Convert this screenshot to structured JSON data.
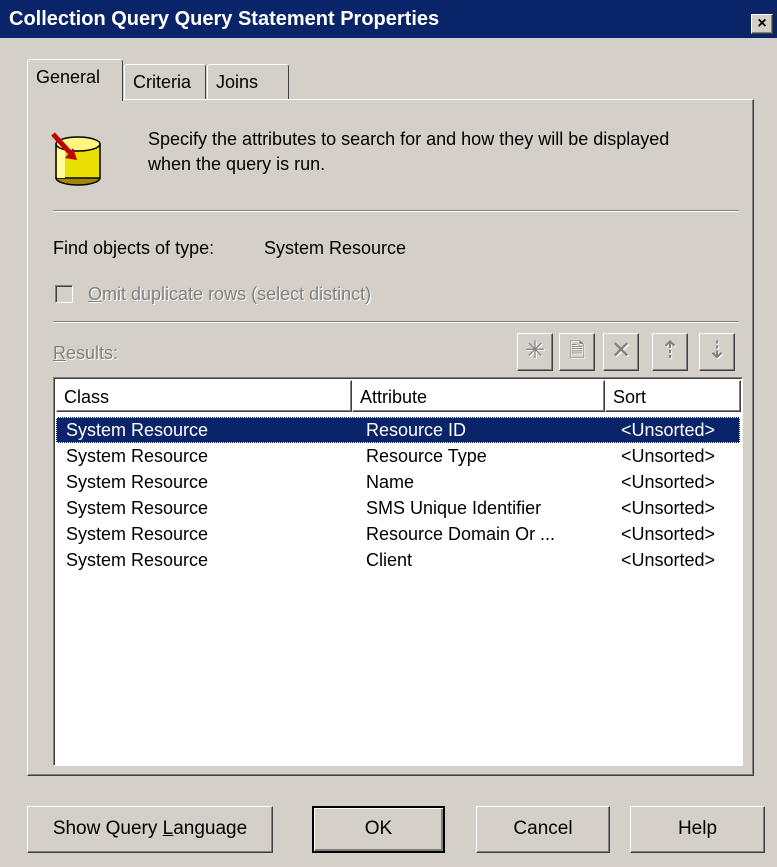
{
  "window": {
    "title": "Collection Query Query Statement Properties",
    "close_glyph": "×"
  },
  "tabs": [
    {
      "label": "General",
      "active": true
    },
    {
      "label": "Criteria",
      "active": false
    },
    {
      "label": "Joins",
      "active": false
    }
  ],
  "general": {
    "description_line1": "Specify the attributes to search for and how they will be displayed",
    "description_line2": "when the query is run.",
    "icon": "database-query-icon",
    "find_label": "Find objects of type:",
    "find_value": "System Resource",
    "omit_duplicates": {
      "mnemonic": "O",
      "label_rest": "mit duplicate rows (select distinct)",
      "checked": false,
      "enabled": false
    },
    "results_mnemonic": "R",
    "results_label_rest": "esults:"
  },
  "toolbar": {
    "new_glyph": "✳",
    "properties_glyph": "🗎",
    "delete_glyph": "✕",
    "move_up_glyph": "⇡",
    "move_down_glyph": "⇣"
  },
  "results": {
    "columns": [
      "Class",
      "Attribute",
      "Sort"
    ],
    "rows": [
      [
        "System Resource",
        "Resource ID",
        "<Unsorted>"
      ],
      [
        "System Resource",
        "Resource Type",
        "<Unsorted>"
      ],
      [
        "System Resource",
        "Name",
        "<Unsorted>"
      ],
      [
        "System Resource",
        "SMS Unique Identifier",
        "<Unsorted>"
      ],
      [
        "System Resource",
        "Resource Domain Or ...",
        "<Unsorted>"
      ],
      [
        "System Resource",
        "Client",
        "<Unsorted>"
      ]
    ],
    "selected_index": 0
  },
  "buttons": {
    "show_query_prefix": "Show Query ",
    "show_query_mnemonic": "L",
    "show_query_suffix": "anguage",
    "ok": "OK",
    "cancel": "Cancel",
    "help": "Help"
  },
  "colors": {
    "titlebar": "#0a246a",
    "face": "#d4d0c8",
    "selection": "#0a246a"
  }
}
